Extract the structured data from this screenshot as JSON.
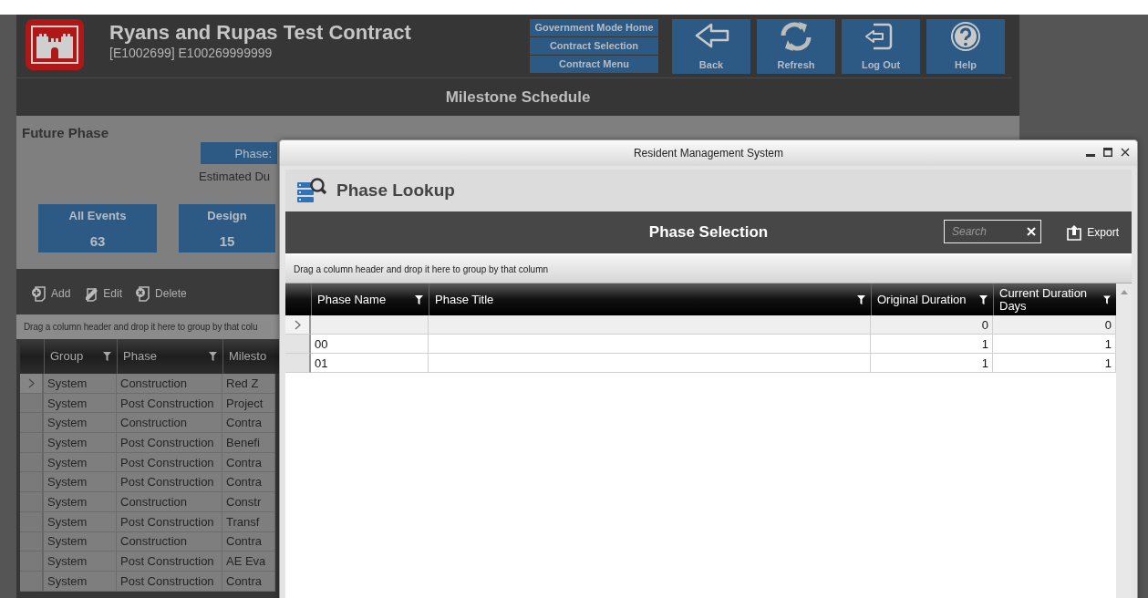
{
  "app": {
    "title": "Ryans and Rupas Test Contract",
    "subtitle": "[E1002699] E100269999999",
    "nav_links": [
      "Government Mode Home",
      "Contract Selection",
      "Contract Menu"
    ],
    "nav_buttons": [
      {
        "kind": "back",
        "label": "Back"
      },
      {
        "kind": "refresh",
        "label": "Refresh"
      },
      {
        "kind": "logout",
        "label": "Log Out"
      },
      {
        "kind": "help",
        "label": "Help"
      }
    ],
    "page_title": "Milestone Schedule",
    "section_title": "Future Phase",
    "phase_label": "Phase:",
    "estimated_label": "Estimated Du",
    "tiles": [
      {
        "label": "All Events",
        "count": "63"
      },
      {
        "label": "Design",
        "count": "15"
      }
    ],
    "toolbar": [
      {
        "kind": "add",
        "label": "Add"
      },
      {
        "kind": "edit",
        "label": "Edit"
      },
      {
        "kind": "delete",
        "label": "Delete"
      }
    ],
    "group_hint": "Drag a column header and drop it here to group by that colu",
    "grid": {
      "columns": [
        "Group",
        "Phase",
        "Milesto"
      ],
      "rows": [
        {
          "selected": true,
          "cells": [
            "System",
            "Construction",
            "Red Z"
          ]
        },
        {
          "selected": false,
          "cells": [
            "System",
            "Post Construction",
            "Project"
          ]
        },
        {
          "selected": false,
          "cells": [
            "System",
            "Construction",
            "Contra"
          ]
        },
        {
          "selected": false,
          "cells": [
            "System",
            "Post Construction",
            "Benefi"
          ]
        },
        {
          "selected": false,
          "cells": [
            "System",
            "Post Construction",
            "Contra"
          ]
        },
        {
          "selected": false,
          "cells": [
            "System",
            "Post Construction",
            "Contra"
          ]
        },
        {
          "selected": false,
          "cells": [
            "System",
            "Construction",
            "Constr"
          ]
        },
        {
          "selected": false,
          "cells": [
            "System",
            "Post Construction",
            "Transf"
          ]
        },
        {
          "selected": false,
          "cells": [
            "System",
            "Construction",
            "Contra"
          ]
        },
        {
          "selected": false,
          "cells": [
            "System",
            "Post Construction",
            "AE Eva"
          ]
        },
        {
          "selected": false,
          "cells": [
            "System",
            "Post Construction",
            "Contra"
          ]
        }
      ]
    }
  },
  "dialog": {
    "title": "Resident Management System",
    "heading": "Phase Lookup",
    "bar_title": "Phase Selection",
    "search": {
      "placeholder": "Search"
    },
    "export_label": "Export",
    "group_hint": "Drag a column header and drop it here to group by that column",
    "grid": {
      "columns": [
        "Phase Name",
        "Phase Title",
        "Original Duration",
        "Current Duration Days"
      ],
      "rows": [
        {
          "selected": true,
          "cells": [
            "",
            "",
            "0",
            "0"
          ]
        },
        {
          "selected": false,
          "cells": [
            "00",
            "",
            "1",
            "1"
          ]
        },
        {
          "selected": false,
          "cells": [
            "01",
            "",
            "1",
            "1"
          ]
        }
      ]
    }
  }
}
